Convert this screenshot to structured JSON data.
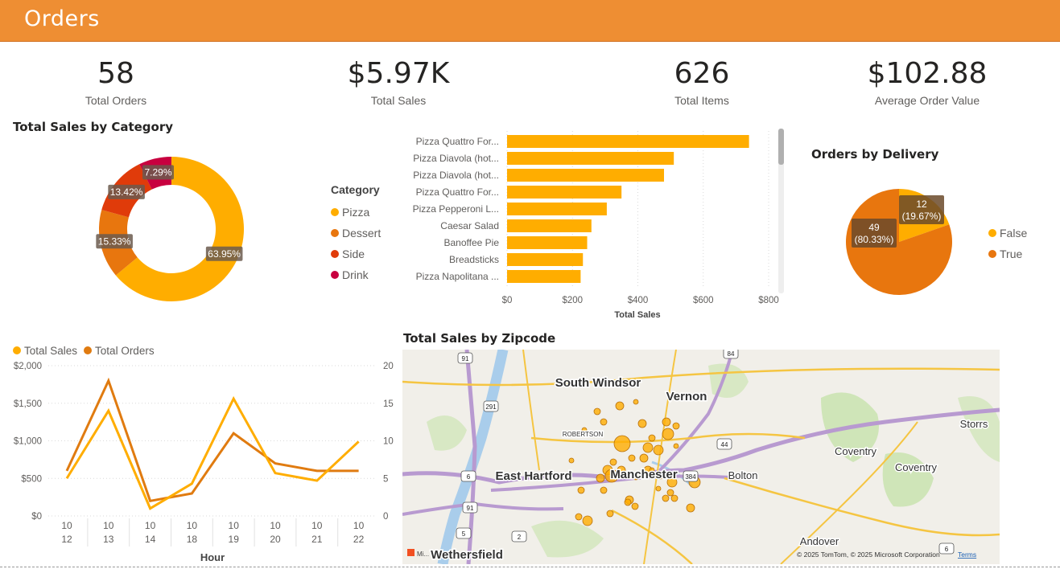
{
  "header": {
    "title": "Orders",
    "color": "#ee8e33"
  },
  "kpis": [
    {
      "value": "58",
      "label": "Total Orders"
    },
    {
      "value": "$5.97K",
      "label": "Total Sales"
    },
    {
      "value": "626",
      "label": "Total Items"
    },
    {
      "value": "$102.88",
      "label": "Average Order Value"
    }
  ],
  "donut": {
    "title": "Total Sales by Category",
    "legend_title": "Category",
    "slices": [
      {
        "name": "Pizza",
        "pct": 63.95,
        "label": "63.95%",
        "color": "#ffad00"
      },
      {
        "name": "Dessert",
        "pct": 15.33,
        "label": "15.33%",
        "color": "#e8760e"
      },
      {
        "name": "Side",
        "pct": 13.42,
        "label": "13.42%",
        "color": "#e03b0a"
      },
      {
        "name": "Drink",
        "pct": 7.29,
        "label": "7.29%",
        "color": "#c8003f"
      }
    ]
  },
  "bar": {
    "xlabel": "Total Sales",
    "ticks": [
      "$0",
      "$200",
      "$400",
      "$600",
      "$800"
    ],
    "color": "#ffad00",
    "items": [
      {
        "name": "Pizza Quattro For...",
        "value": 740
      },
      {
        "name": "Pizza Diavola (hot...",
        "value": 510
      },
      {
        "name": "Pizza Diavola (hot...",
        "value": 480
      },
      {
        "name": "Pizza Quattro For...",
        "value": 350
      },
      {
        "name": "Pizza Pepperoni L...",
        "value": 305
      },
      {
        "name": "Caesar Salad",
        "value": 258
      },
      {
        "name": "Banoffee Pie",
        "value": 245
      },
      {
        "name": "Breadsticks",
        "value": 232
      },
      {
        "name": "Pizza Napolitana ...",
        "value": 225
      }
    ]
  },
  "pie": {
    "title": "Orders by Delivery",
    "slices": [
      {
        "name": "False",
        "count": "12",
        "pct_label": "(19.67%)",
        "pct": 19.67,
        "color": "#ffad00"
      },
      {
        "name": "True",
        "count": "49",
        "pct_label": "(80.33%)",
        "pct": 80.33,
        "color": "#e8760e"
      }
    ]
  },
  "line": {
    "legend": [
      {
        "name": "Total Sales",
        "color": "#ffad00"
      },
      {
        "name": "Total Orders",
        "color": "#e07b10"
      }
    ],
    "xlabel": "Hour",
    "x_top": [
      "10",
      "10",
      "10",
      "10",
      "10",
      "10",
      "10",
      "10"
    ],
    "x_bottom": [
      "12",
      "13",
      "14",
      "18",
      "19",
      "20",
      "21",
      "22"
    ],
    "left_ticks": [
      "$2,000",
      "$1,500",
      "$1,000",
      "$500",
      "$0"
    ],
    "right_ticks": [
      "20",
      "15",
      "10",
      "5",
      "0"
    ],
    "sales": [
      500,
      1400,
      100,
      430,
      1560,
      570,
      470,
      990
    ],
    "orders": [
      6,
      18,
      2,
      3,
      11,
      7,
      6,
      6
    ]
  },
  "map": {
    "title": "Total Sales by Zipcode",
    "labels": [
      "South Windsor",
      "Vernon",
      "East Hartford",
      "Manchester",
      "Bolton",
      "Coventry",
      "Coventry",
      "Storrs",
      "Andover",
      "Wethersfield",
      "ROBERTSON"
    ],
    "route_shields": [
      "84",
      "91",
      "291",
      "44",
      "6",
      "91",
      "5",
      "2",
      "384",
      "6"
    ],
    "attribution": "© 2025 TomTom, © 2025 Microsoft Corporation",
    "terms": "Terms",
    "logo": "Mi..."
  }
}
